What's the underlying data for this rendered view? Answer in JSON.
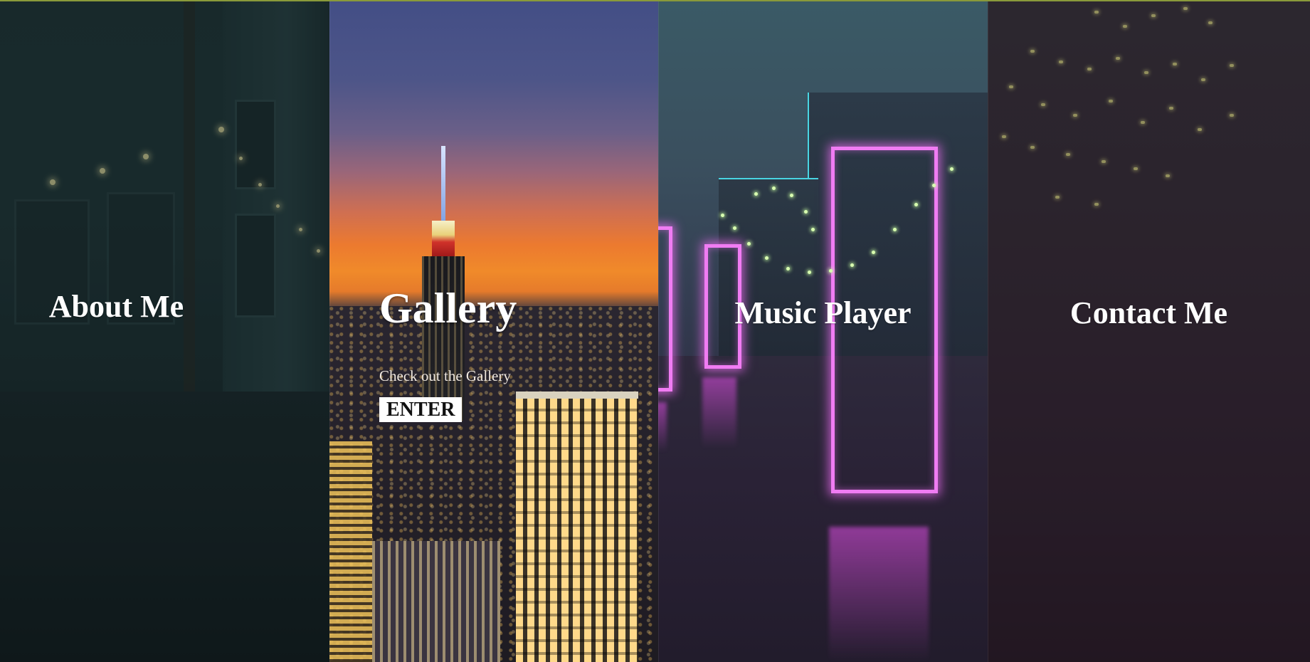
{
  "panels": [
    {
      "title": "About Me"
    },
    {
      "title": "Gallery",
      "subtitle": "Check out the Gallery",
      "button_label": "ENTER"
    },
    {
      "title": "Music Player"
    },
    {
      "title": "Contact Me"
    }
  ],
  "colors": {
    "accent_top_line": "#8a9a3a",
    "neon_pink": "#f07cf3",
    "neon_cyan": "#49d5e2",
    "button_bg": "#ffffff"
  }
}
